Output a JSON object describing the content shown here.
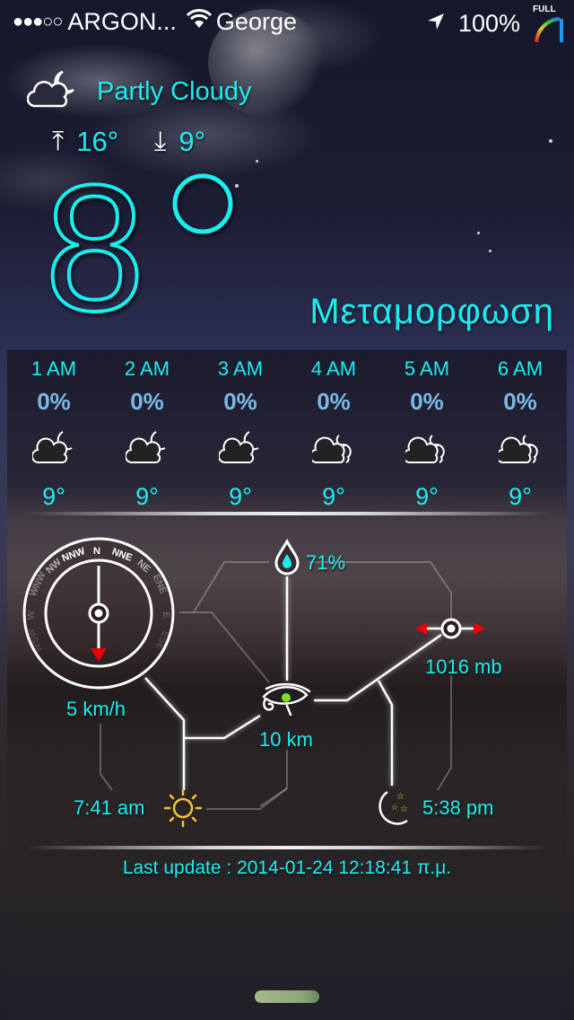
{
  "status_bar": {
    "signal_dots": "●●●○○",
    "carrier": "ARGON...",
    "wifi_name": "George",
    "battery": "100%",
    "battery_badge": "FULL"
  },
  "current": {
    "condition": "Partly Cloudy",
    "condition_icon": "partly-cloudy-night-icon",
    "high": "16°",
    "low": "9°",
    "temperature": "8",
    "location": "Μεταμορφωση"
  },
  "hourly": [
    {
      "time": "1 AM",
      "precip": "0%",
      "icon": "partly-cloudy-night-icon",
      "temp": "9°"
    },
    {
      "time": "2 AM",
      "precip": "0%",
      "icon": "partly-cloudy-night-icon",
      "temp": "9°"
    },
    {
      "time": "3 AM",
      "precip": "0%",
      "icon": "partly-cloudy-night-icon",
      "temp": "9°"
    },
    {
      "time": "4 AM",
      "precip": "0%",
      "icon": "mostly-cloudy-night-icon",
      "temp": "9°"
    },
    {
      "time": "5 AM",
      "precip": "0%",
      "icon": "mostly-cloudy-night-icon",
      "temp": "9°"
    },
    {
      "time": "6 AM",
      "precip": "0%",
      "icon": "mostly-cloudy-night-icon",
      "temp": "9°"
    }
  ],
  "details": {
    "wind_speed": "5 km/h",
    "wind_direction_labels": [
      "NNW",
      "N",
      "NNE",
      "NW",
      "NE",
      "WNW",
      "ENE",
      "W",
      "E",
      "WSW",
      "ESE"
    ],
    "humidity": "71%",
    "pressure": "1016 mb",
    "visibility": "10 km",
    "sunrise": "7:41 am",
    "sunset": "5:38 pm"
  },
  "footer": {
    "last_update": "Last update : 2014-01-24 12:18:41 π.μ."
  },
  "colors": {
    "accent": "#18eef0",
    "precip": "#7ab8e6",
    "sun": "#f2c62a",
    "arrow": "#e8000a",
    "eye_dot": "#7ee01a"
  }
}
